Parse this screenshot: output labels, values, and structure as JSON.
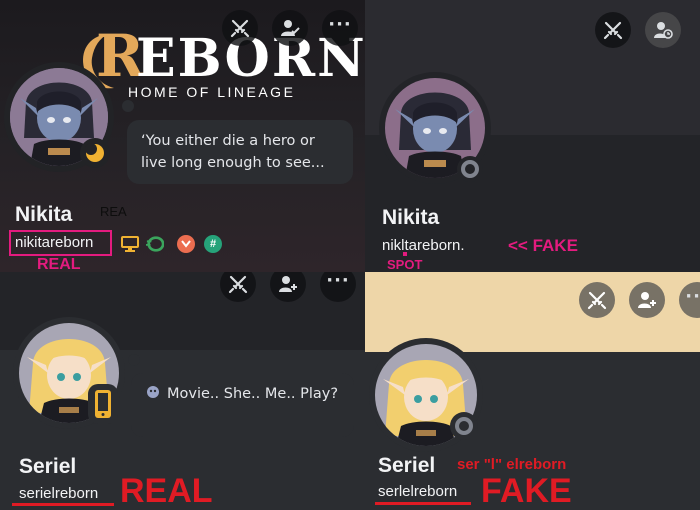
{
  "panels": [
    {
      "display_name": "Nikita",
      "username": "nikitareborn",
      "bio": "‘You either die a hero or live long enough to see...",
      "annotations": {
        "top_label": "REA",
        "bottom_label": "REAL"
      },
      "logo": {
        "title": "REBORN",
        "subtitle": "HOME OF LINEAGE"
      },
      "badges": [
        "desktop-icon",
        "nitro-icon",
        "boost-icon",
        "hashtag-icon"
      ],
      "colors": {
        "annotation": "#e41b7f",
        "logo_accent": "#e3a85a",
        "idle_status": "#f0b232"
      }
    },
    {
      "display_name": "Nikita",
      "username": "nikltareborn.",
      "annotations": {
        "side_label": "<< FAKE",
        "bottom_label": "SPOT"
      },
      "colors": {
        "annotation": "#e41b7f",
        "status": "#80848e"
      }
    },
    {
      "display_name": "Seriel",
      "username": "serielreborn",
      "bio": "Movie.. She.. Me.. Play?",
      "annotations": {
        "big_label": "REAL"
      },
      "colors": {
        "annotation": "#e01b24",
        "mobile_status": "#f0b232"
      }
    },
    {
      "display_name": "Seriel",
      "username": "serlelreborn",
      "annotations": {
        "note": "ser \"l\" elreborn",
        "big_label": "FAKE"
      },
      "colors": {
        "annotation": "#e01b24",
        "banner": "#eed6a8",
        "status": "#80848e"
      }
    }
  ]
}
